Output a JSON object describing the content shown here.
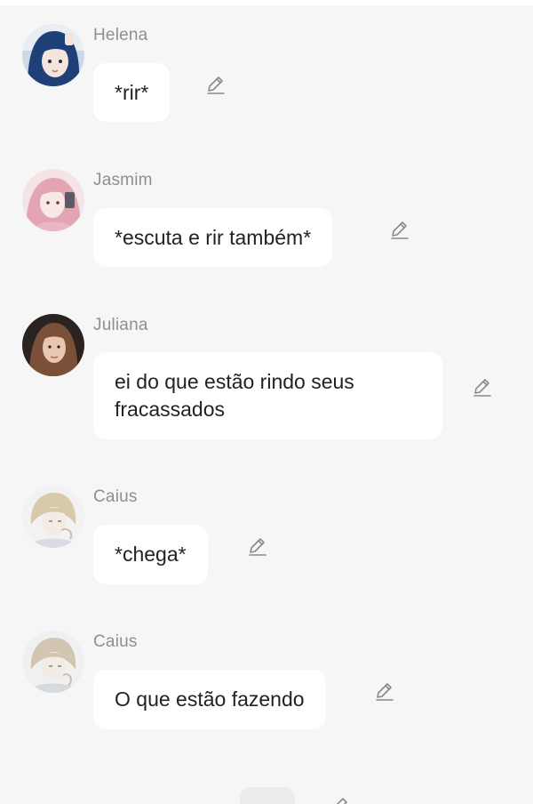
{
  "messages": [
    {
      "author": "Helena",
      "text": "*rir*",
      "edit_icon": "pencil-icon"
    },
    {
      "author": "Jasmim",
      "text": "*escuta e rir também*",
      "edit_icon": "pencil-icon"
    },
    {
      "author": "Juliana",
      "text": "ei do que estão rindo seus fracassados",
      "edit_icon": "pencil-icon"
    },
    {
      "author": "Caius",
      "text": "*chega*",
      "edit_icon": "pencil-icon"
    },
    {
      "author": "Caius",
      "text": "O que estão fazendo",
      "edit_icon": "pencil-icon"
    }
  ],
  "colors": {
    "background": "#f6f6f6",
    "bubble": "#ffffff",
    "author": "#8f8f8f",
    "text": "#222222",
    "icon": "#8a8a8a"
  }
}
